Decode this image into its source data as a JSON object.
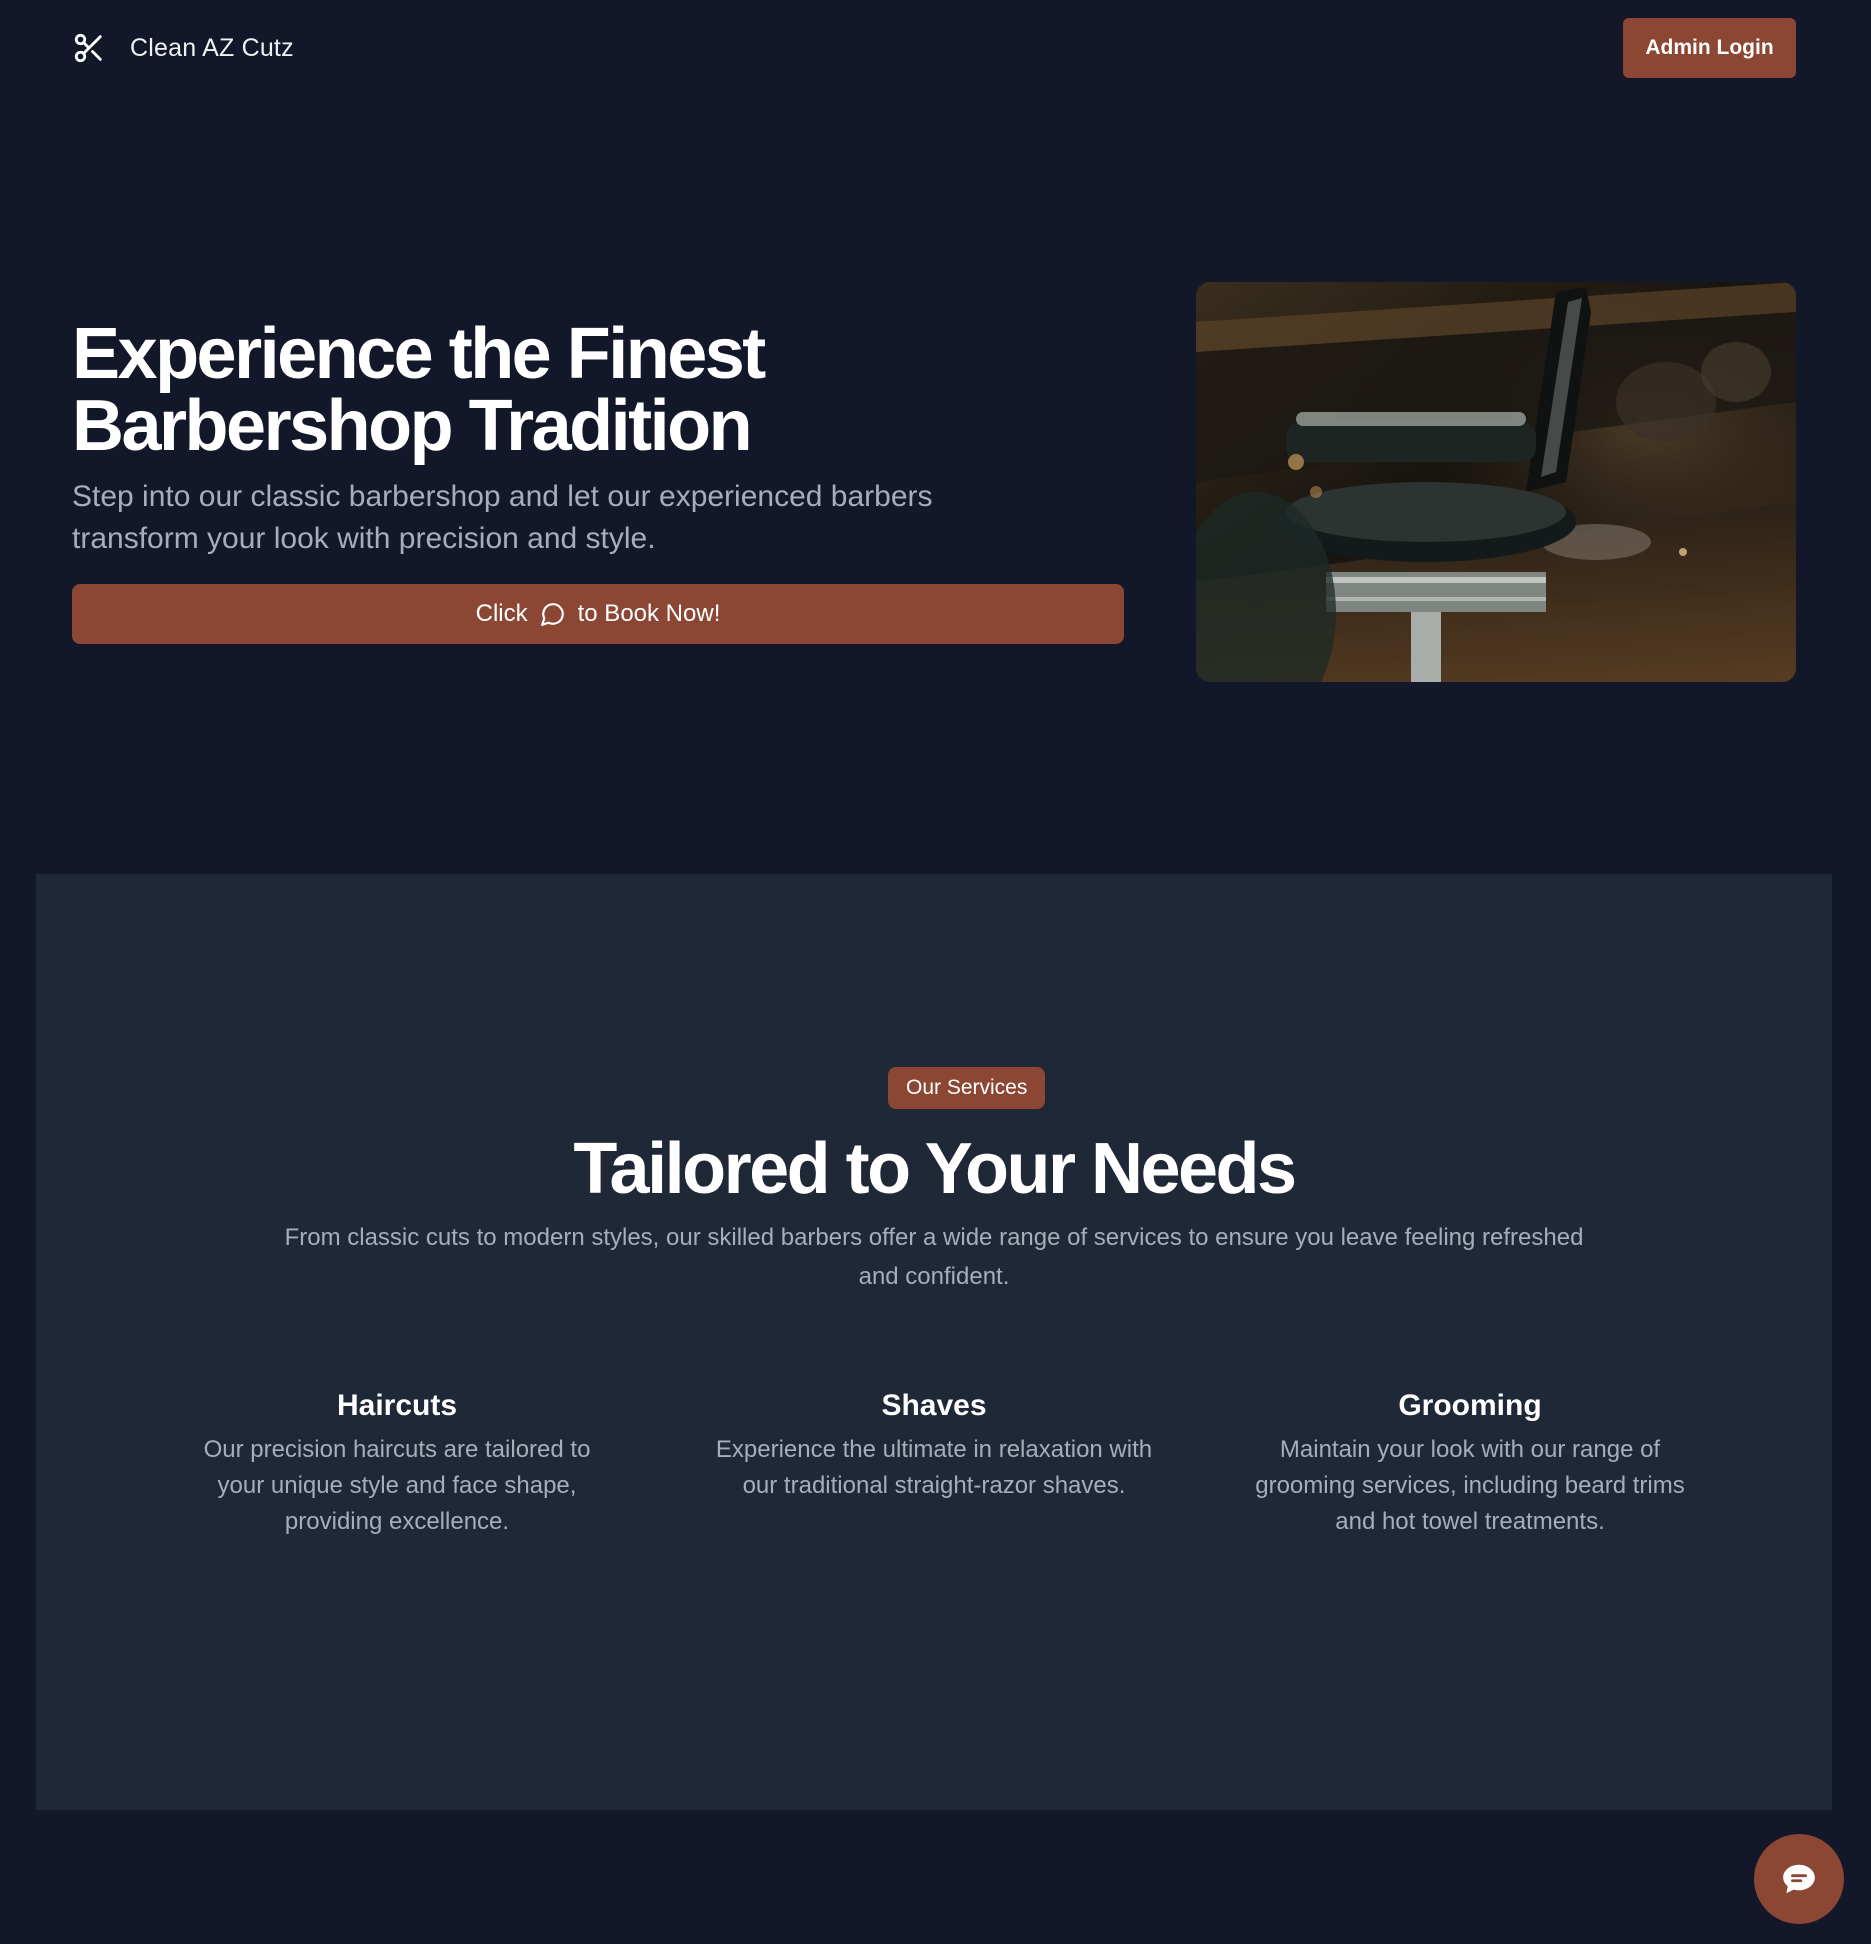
{
  "header": {
    "brand_name": "Clean AZ Cutz",
    "brand_icon": "scissors-icon",
    "admin_button": "Admin Login"
  },
  "hero": {
    "title_line1": "Experience the Finest",
    "title_line2": "Barbershop Tradition",
    "subtitle": "Step into our classic barbershop and let our experienced barbers transform your look with precision and style.",
    "book_button": {
      "prefix": "Click",
      "icon": "chat-bubble-icon",
      "suffix": "to Book Now!"
    },
    "image_icon": "barber-chair-photo"
  },
  "services": {
    "badge": "Our Services",
    "title": "Tailored to Your Needs",
    "subtitle": "From classic cuts to modern styles, our skilled barbers offer a wide range of services to ensure you leave feeling refreshed and confident.",
    "items": [
      {
        "title": "Haircuts",
        "description": "Our precision haircuts are tailored to your unique style and face shape, providing excellence."
      },
      {
        "title": "Shaves",
        "description": "Experience the ultimate in relaxation with our traditional straight-razor shaves."
      },
      {
        "title": "Grooming",
        "description": "Maintain your look with our range of grooming services, including beard trims and hot towel treatments."
      }
    ]
  },
  "chat_widget": {
    "icon": "chat-icon"
  },
  "colors": {
    "background": "#121829",
    "section_background": "#1f2837",
    "accent": "#8b4634",
    "muted_text": "#a7adb9",
    "text": "#ffffff"
  }
}
